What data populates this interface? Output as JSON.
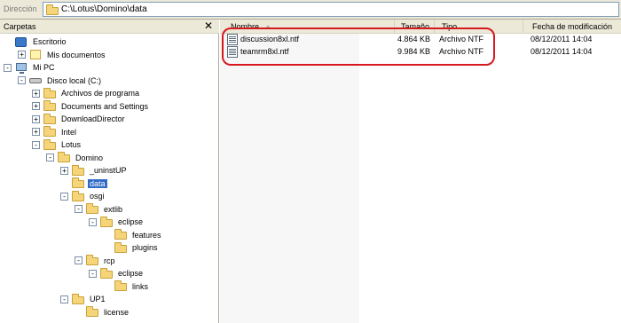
{
  "address": {
    "label": "Dirección",
    "path": "C:\\Lotus\\Domino\\data"
  },
  "left_pane": {
    "title": "Carpetas",
    "close_glyph": "✕"
  },
  "tree": [
    {
      "label": "Escritorio",
      "icon": "desktop-icon",
      "expander": "",
      "selected": false
    },
    {
      "label": "Mis documentos",
      "icon": "documents-icon",
      "expander": "+",
      "selected": false
    },
    {
      "label": "Mi PC",
      "icon": "computer-icon",
      "expander": "−",
      "selected": false
    },
    {
      "label": "Disco local (C:)",
      "icon": "drive-icon",
      "expander": "−",
      "selected": false
    },
    {
      "label": "Archivos de programa",
      "icon": "folder-icon",
      "expander": "+",
      "selected": false
    },
    {
      "label": "Documents and Settings",
      "icon": "folder-icon",
      "expander": "+",
      "selected": false
    },
    {
      "label": "DownloadDirector",
      "icon": "folder-icon",
      "expander": "+",
      "selected": false
    },
    {
      "label": "Intel",
      "icon": "folder-icon",
      "expander": "+",
      "selected": false
    },
    {
      "label": "Lotus",
      "icon": "folder-icon",
      "expander": "−",
      "selected": false
    },
    {
      "label": "Domino",
      "icon": "folder-icon",
      "expander": "−",
      "selected": false
    },
    {
      "label": "_uninstUP",
      "icon": "folder-icon",
      "expander": "+",
      "selected": false
    },
    {
      "label": "data",
      "icon": "folder-icon",
      "expander": "",
      "selected": true
    },
    {
      "label": "osgi",
      "icon": "folder-icon",
      "expander": "−",
      "selected": false
    },
    {
      "label": "extlib",
      "icon": "folder-icon",
      "expander": "−",
      "selected": false
    },
    {
      "label": "eclipse",
      "icon": "folder-icon",
      "expander": "−",
      "selected": false
    },
    {
      "label": "features",
      "icon": "folder-icon",
      "expander": "",
      "selected": false
    },
    {
      "label": "plugins",
      "icon": "folder-icon",
      "expander": "",
      "selected": false
    },
    {
      "label": "rcp",
      "icon": "folder-icon",
      "expander": "−",
      "selected": false
    },
    {
      "label": "eclipse",
      "icon": "folder-icon",
      "expander": "−",
      "selected": false
    },
    {
      "label": "links",
      "icon": "folder-icon",
      "expander": "",
      "selected": false
    },
    {
      "label": "UP1",
      "icon": "folder-icon",
      "expander": "−",
      "selected": false
    },
    {
      "label": "license",
      "icon": "folder-icon",
      "expander": "",
      "selected": false
    }
  ],
  "columns": {
    "name": "Nombre",
    "size": "Tamaño",
    "type": "Tipo",
    "date": "Fecha de modificación"
  },
  "files": [
    {
      "name": "discussion8xl.ntf",
      "size": "4.864 KB",
      "type": "Archivo NTF",
      "date": "08/12/2011 14:04",
      "icon": "ntf-file-icon"
    },
    {
      "name": "teamrm8xl.ntf",
      "size": "9.984 KB",
      "type": "Archivo NTF",
      "date": "08/12/2011 14:04",
      "icon": "ntf-file-icon"
    }
  ],
  "colors": {
    "selection": "#316ac5",
    "highlight_outline": "#d8181f",
    "chrome": "#ece9d8"
  }
}
